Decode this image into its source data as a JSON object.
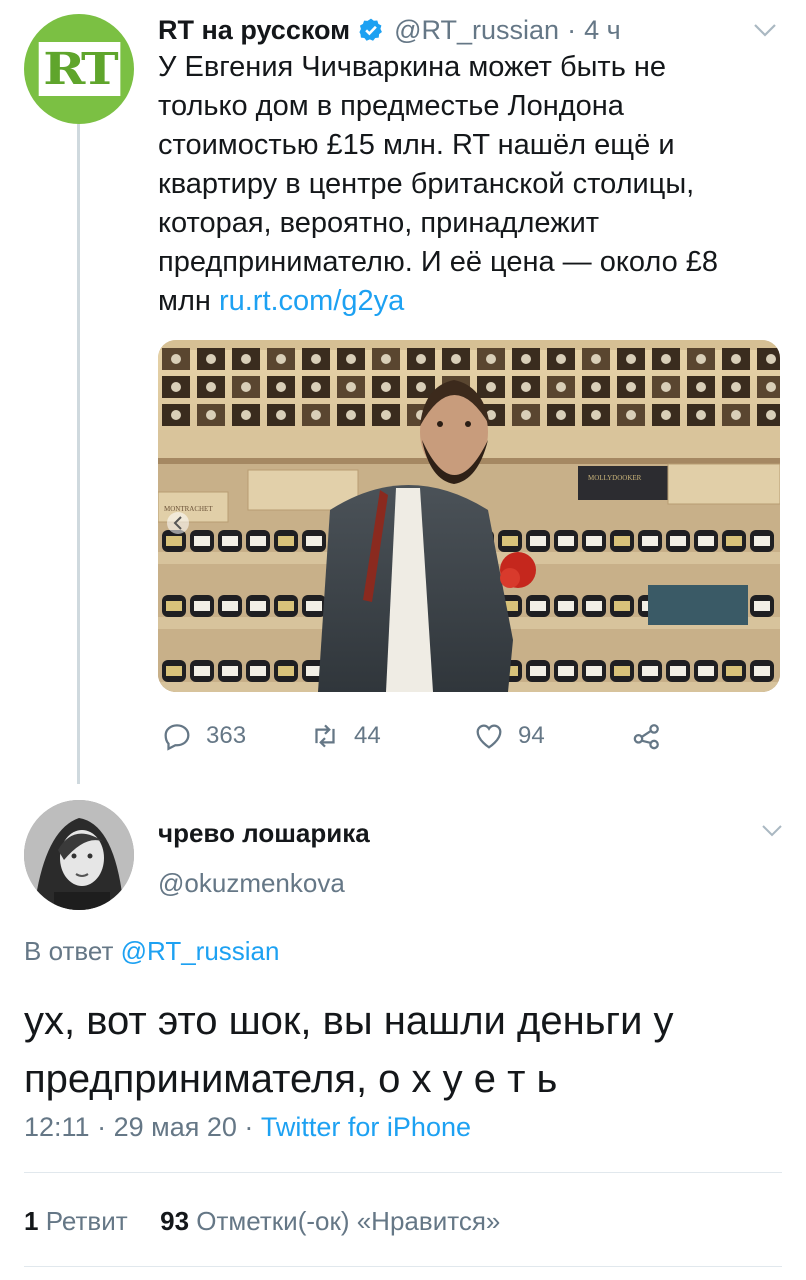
{
  "tweet": {
    "avatar_text": "RT",
    "display_name": "RT на русском",
    "handle": "@RT_russian",
    "separator": "·",
    "time": "4 ч",
    "text": "У Евгения Чичваркина может быть не только дом в предместье Лондона стоимостью £15 млн. RT нашёл ещё и квартиру в центре британской столицы, которая, вероятно, принадлежит предпринимателю. И её цена — около £8 млн",
    "link": "ru.rt.com/g2ya",
    "replies": "363",
    "retweets": "44",
    "likes": "94",
    "media_labels": {
      "crate_left": "MONTRACHET",
      "crate_right": "MOLLYDOOKER"
    }
  },
  "reply": {
    "display_name": "чрево лошарика",
    "handle": "@okuzmenkova",
    "reply_prefix": "В ответ",
    "reply_handle": "@RT_russian",
    "text": "ух, вот это шок, вы нашли деньги у предпринимателя, о х у е т ь",
    "time": "12:11",
    "separator": "·",
    "date": "29 мая 20",
    "source": "Twitter for iPhone",
    "retweet_count": "1",
    "retweet_label": "Ретвит",
    "like_count": "93",
    "like_label": "Отметки(-ок) «Нравится»"
  },
  "colors": {
    "accent": "#1da1f2",
    "secondary_text": "#657786",
    "rt_green": "#7bc043",
    "divider": "#e1e8ed"
  },
  "icons": [
    "verified-badge-icon",
    "chevron-down-icon",
    "reply-icon",
    "retweet-icon",
    "like-icon",
    "share-icon"
  ]
}
